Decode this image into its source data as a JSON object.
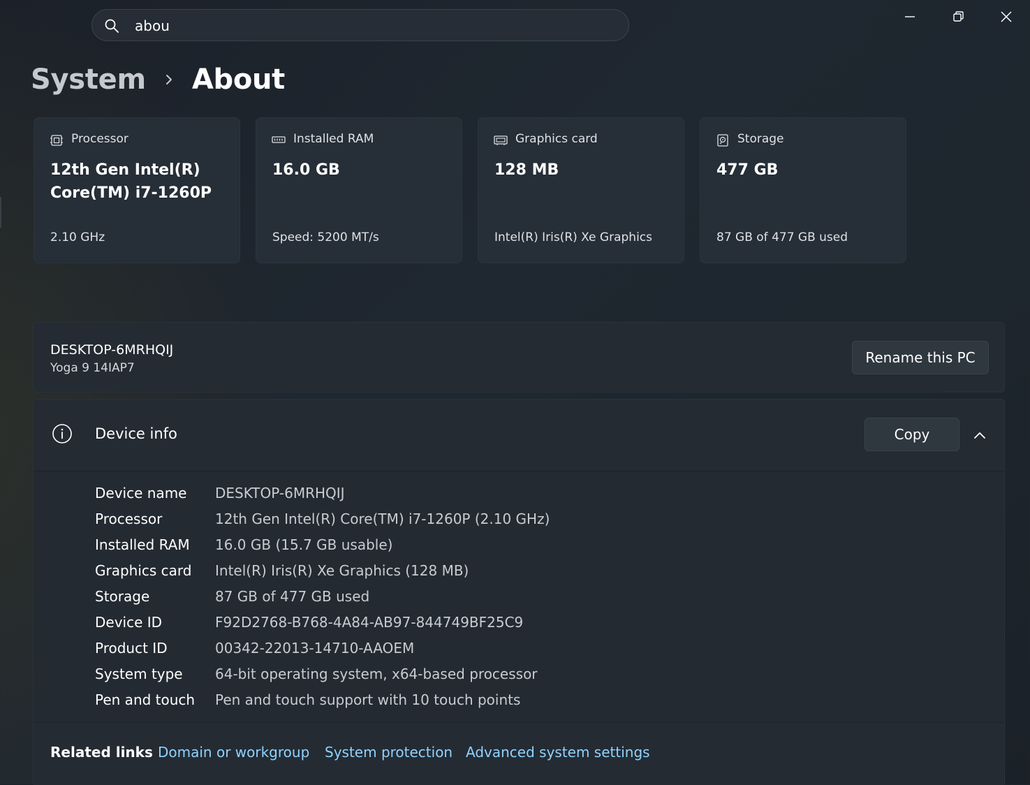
{
  "search": {
    "value": "abou",
    "icon": "search-icon"
  },
  "window_controls": {
    "minimize_icon": "minimize-icon",
    "restore_icon": "restore-icon",
    "close_icon": "close-icon"
  },
  "breadcrumb": {
    "parent": "System",
    "separator_icon": "chevron-right-icon",
    "current": "About"
  },
  "cards": [
    {
      "icon": "processor-icon",
      "label": "Processor",
      "value": "12th Gen Intel(R) Core(TM) i7-1260P",
      "sub": "2.10 GHz"
    },
    {
      "icon": "ram-icon",
      "label": "Installed RAM",
      "value": "16.0 GB",
      "sub": "Speed: 5200 MT/s"
    },
    {
      "icon": "graphics-card-icon",
      "label": "Graphics card",
      "value": "128 MB",
      "sub": "Intel(R) Iris(R) Xe Graphics"
    },
    {
      "icon": "storage-icon",
      "label": "Storage",
      "value": "477 GB",
      "sub": "87 GB of 477 GB used"
    }
  ],
  "pc": {
    "name": "DESKTOP-6MRHQIJ",
    "model": "Yoga 9 14IAP7",
    "rename_label": "Rename this PC"
  },
  "device_info": {
    "title": "Device info",
    "icon": "info-icon",
    "copy_label": "Copy",
    "collapse_icon": "chevron-up-icon",
    "rows": [
      {
        "key": "Device name",
        "value": "DESKTOP-6MRHQIJ"
      },
      {
        "key": "Processor",
        "value": "12th Gen Intel(R) Core(TM) i7-1260P (2.10 GHz)"
      },
      {
        "key": "Installed RAM",
        "value": "16.0 GB (15.7 GB usable)"
      },
      {
        "key": "Graphics card",
        "value": "Intel(R) Iris(R) Xe Graphics (128 MB)"
      },
      {
        "key": "Storage",
        "value": "87 GB of 477 GB used"
      },
      {
        "key": "Device ID",
        "value": "F92D2768-B768-4A84-AB97-844749BF25C9"
      },
      {
        "key": "Product ID",
        "value": "00342-22013-14710-AAOEM"
      },
      {
        "key": "System type",
        "value": "64-bit operating system, x64-based processor"
      },
      {
        "key": "Pen and touch",
        "value": "Pen and touch support with 10 touch points"
      }
    ]
  },
  "related_links": {
    "title": "Related links",
    "links": [
      "Domain or workgroup",
      "System protection",
      "Advanced system settings"
    ]
  },
  "colors": {
    "accent_link": "#8fd3ff",
    "card_bg": "#262e37",
    "panel_bg": "#242b33"
  }
}
